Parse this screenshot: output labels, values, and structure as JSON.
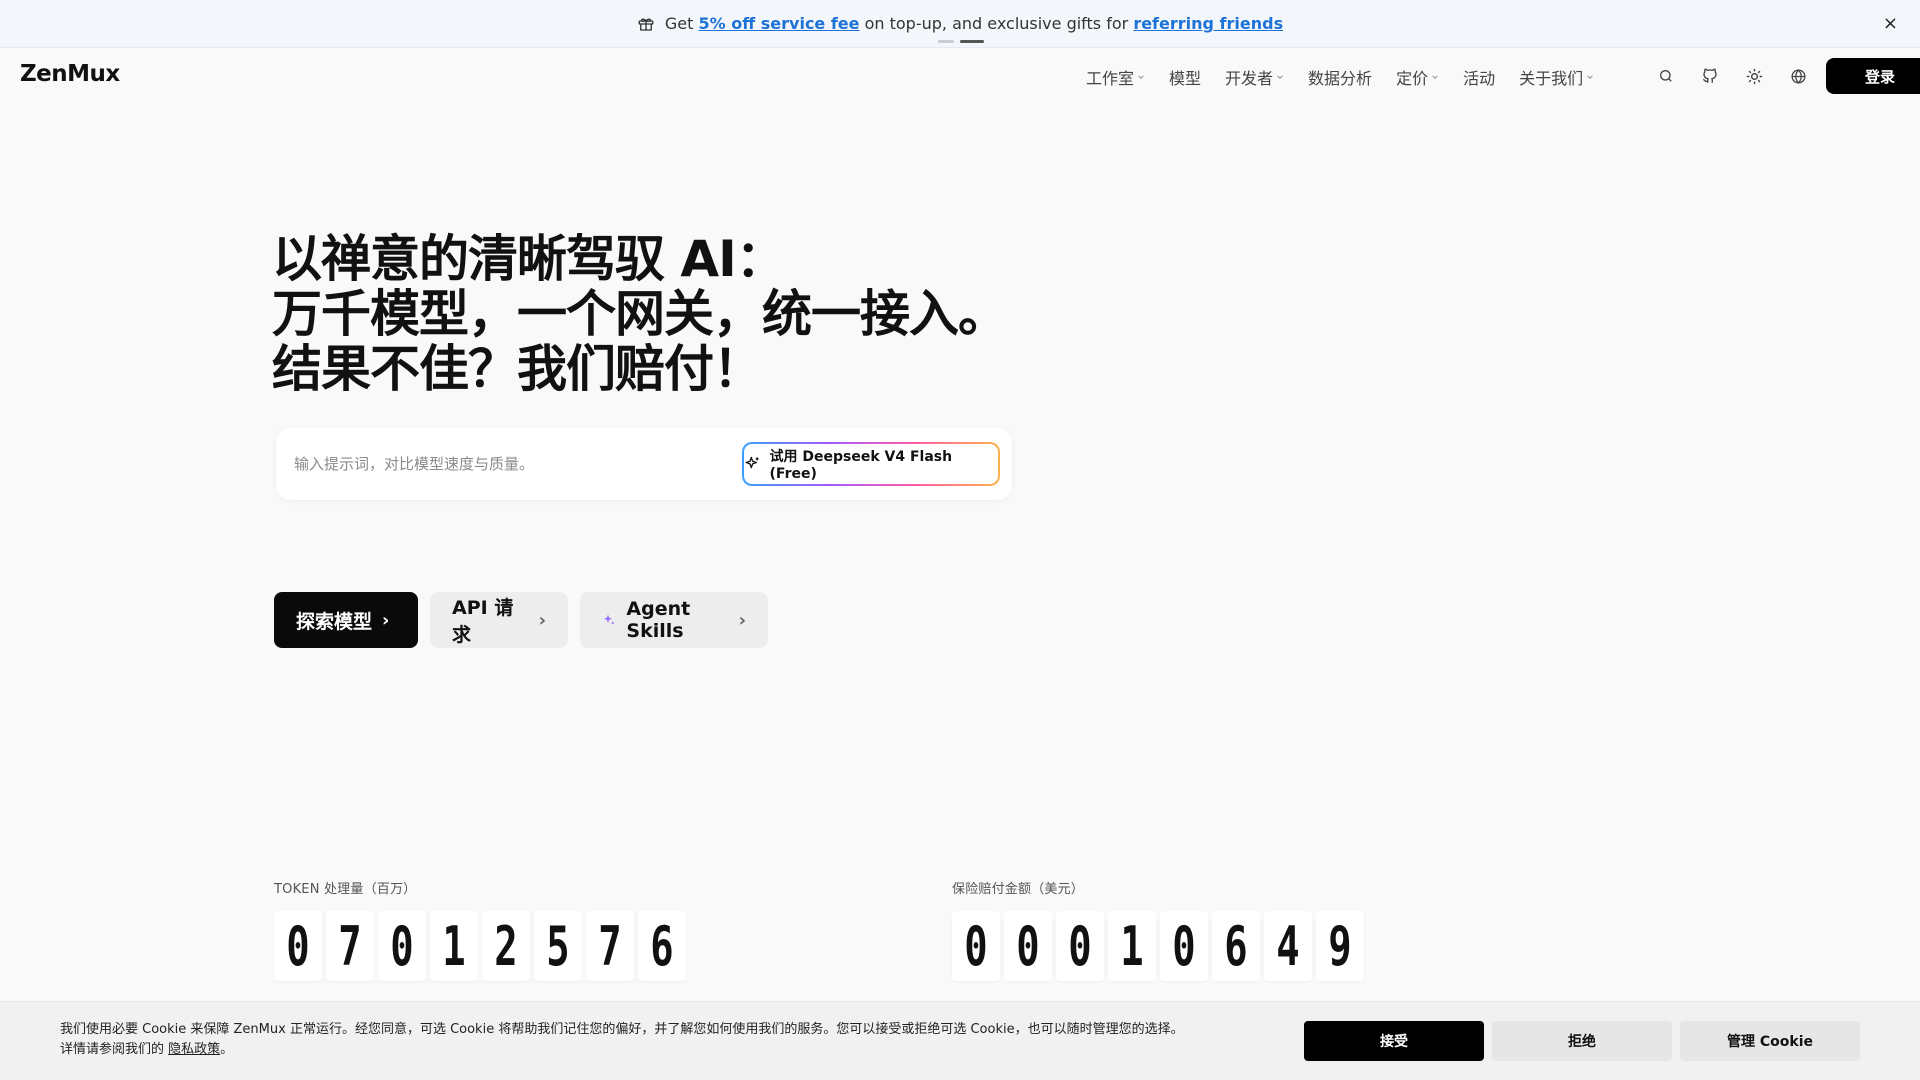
{
  "banner": {
    "prefix": "Get ",
    "link1": "5% off service fee",
    "middle": " on top-up, and exclusive gifts for ",
    "link2": "referring friends",
    "close_symbol": "×",
    "icon": "gift-icon"
  },
  "header": {
    "logo": "ZenMux",
    "nav": [
      {
        "label": "工作室",
        "has_dropdown": true
      },
      {
        "label": "模型",
        "has_dropdown": false
      },
      {
        "label": "开发者",
        "has_dropdown": true
      },
      {
        "label": "数据分析",
        "has_dropdown": false
      },
      {
        "label": "定价",
        "has_dropdown": true
      },
      {
        "label": "活动",
        "has_dropdown": false
      },
      {
        "label": "关于我们",
        "has_dropdown": true
      }
    ],
    "icons": [
      "search-icon",
      "github-icon",
      "sun-icon",
      "globe-icon"
    ],
    "login_label": "登录"
  },
  "hero": {
    "line1": "以禅意的清晰驾驭 AI：",
    "line2": "万千模型，一个网关，统一接入。",
    "line3": "结果不佳？我们赔付！",
    "prompt_placeholder": "输入提示词，对比模型速度与质量。",
    "try_label": "试用 Deepseek V4 Flash (Free)"
  },
  "cta": {
    "explore": "探索模型",
    "api": "API 请求",
    "agent": "Agent Skills",
    "arrow": "›"
  },
  "counters": [
    {
      "label": "TOKEN 处理量（百万）",
      "digits": [
        "0",
        "7",
        "0",
        "1",
        "2",
        "5",
        "7",
        "6"
      ]
    },
    {
      "label": "保险赔付金额（美元）",
      "digits": [
        "0",
        "0",
        "0",
        "1",
        "0",
        "6",
        "4",
        "9"
      ]
    }
  ],
  "cookie": {
    "text": "我们使用必要 Cookie 来保障 ZenMux 正常运行。经您同意，可选 Cookie 将帮助我们记住您的偏好，并了解您如何使用我们的服务。您可以接受或拒绝可选 Cookie，也可以随时管理您的选择。详情请参阅我们的 ",
    "policy_link": "隐私政策",
    "end": "。",
    "accept": "接受",
    "reject": "拒绝",
    "manage": "管理 Cookie"
  }
}
